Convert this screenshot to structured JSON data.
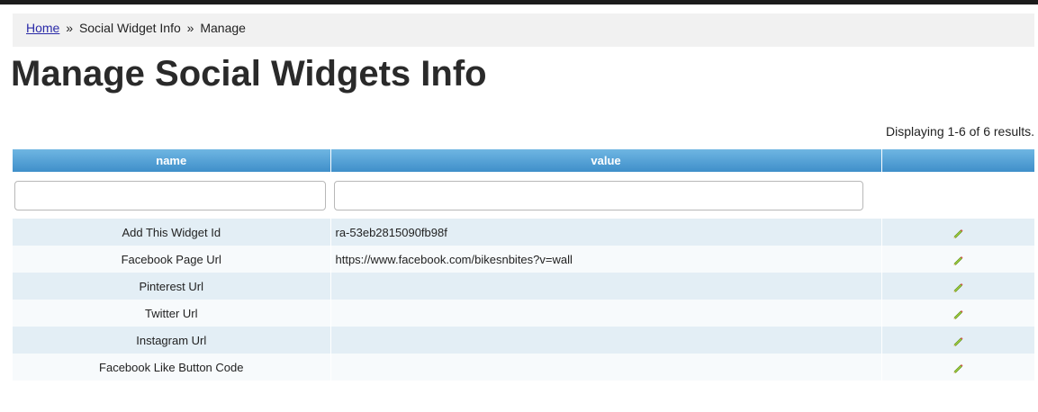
{
  "breadcrumb": {
    "home": "Home",
    "separator": "»",
    "items": [
      "Social Widget Info",
      "Manage"
    ]
  },
  "page_title": "Manage Social Widgets Info",
  "summary": "Displaying 1-6 of 6 results.",
  "grid": {
    "columns": [
      "name",
      "value",
      ""
    ],
    "filters": {
      "name_value": "",
      "value_value": ""
    },
    "rows": [
      {
        "name": "Add This Widget Id",
        "value": "ra-53eb2815090fb98f",
        "action_icon": "edit-pencil-icon"
      },
      {
        "name": "Facebook Page Url",
        "value": "https://www.facebook.com/bikesnbites?v=wall",
        "action_icon": "edit-pencil-icon"
      },
      {
        "name": "Pinterest Url",
        "value": "",
        "action_icon": "edit-pencil-icon"
      },
      {
        "name": "Twitter Url",
        "value": "",
        "action_icon": "edit-pencil-icon"
      },
      {
        "name": "Instagram Url",
        "value": "",
        "action_icon": "edit-pencil-icon"
      },
      {
        "name": "Facebook Like Button Code",
        "value": "",
        "action_icon": "edit-pencil-icon"
      }
    ]
  },
  "colors": {
    "header_gradient_top": "#6fb6e2",
    "header_gradient_bottom": "#3f8fca",
    "row_odd": "#e3eef5",
    "row_even": "#f7fafc",
    "link": "#2a2aa8"
  }
}
